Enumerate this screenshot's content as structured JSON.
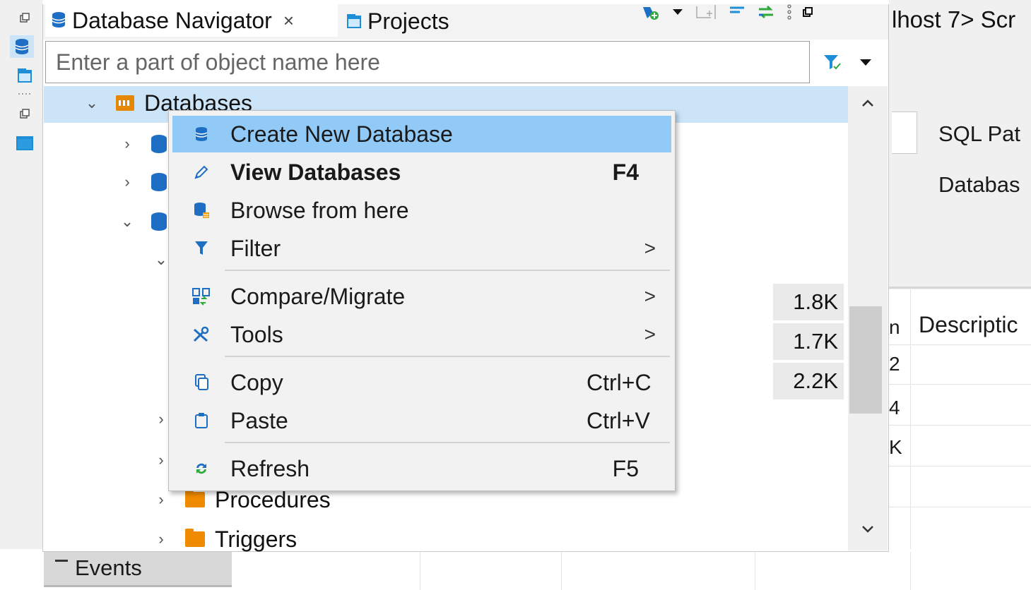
{
  "editor": {
    "tab_fragment": "lhost 7> Scr",
    "form_label_sql": "SQL Pat",
    "form_label_db": "Databas",
    "grid_header_desc": "Descriptic",
    "grid_header_n": "n",
    "grid_frag_1": "2",
    "grid_frag_2": "4",
    "grid_frag_3": "K"
  },
  "navigator": {
    "tab_label": "Database Navigator",
    "close_glyph": "×",
    "projects_label": "Projects",
    "filter_placeholder": "Enter a part of object name here",
    "tree": {
      "databases_label": "Databases",
      "procedures_label": "Procedures",
      "triggers_label": "Triggers",
      "events_label": "Events"
    },
    "sizes": [
      "1.8K",
      "1.7K",
      "2.2K"
    ]
  },
  "context_menu": {
    "items": [
      {
        "label": "Create New Database",
        "icon": "database-icon",
        "shortcut": "",
        "submenu": false
      },
      {
        "label": "View Databases",
        "icon": "pencil-icon",
        "shortcut": "F4",
        "submenu": false
      },
      {
        "label": "Browse from here",
        "icon": "database-browse-icon",
        "shortcut": "",
        "submenu": false
      },
      {
        "label": "Filter",
        "icon": "filter-icon",
        "shortcut": "",
        "submenu": true
      },
      {
        "label": "Compare/Migrate",
        "icon": "compare-icon",
        "shortcut": "",
        "submenu": true
      },
      {
        "label": "Tools",
        "icon": "tools-icon",
        "shortcut": "",
        "submenu": true
      },
      {
        "label": "Copy",
        "icon": "copy-icon",
        "shortcut": "Ctrl+C",
        "submenu": false
      },
      {
        "label": "Paste",
        "icon": "paste-icon",
        "shortcut": "Ctrl+V",
        "submenu": false
      },
      {
        "label": "Refresh",
        "icon": "refresh-icon",
        "shortcut": "F5",
        "submenu": false
      }
    ],
    "submenu_glyph": ">"
  },
  "colors": {
    "selection": "#cce4f7",
    "menu_highlight": "#91c9f7",
    "db_blue": "#1e6fc4",
    "folder_orange": "#f08a00"
  }
}
